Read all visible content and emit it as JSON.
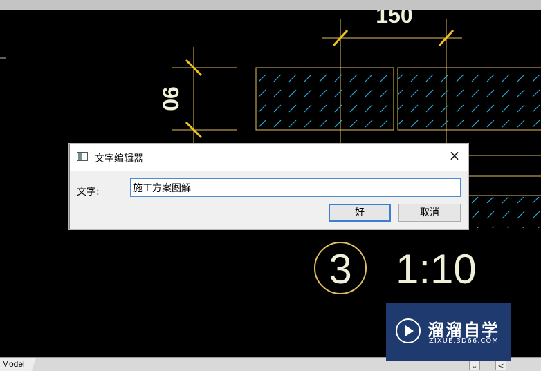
{
  "cad": {
    "dim_top": "150",
    "dim_left": "90",
    "detail_number": "3",
    "scale_label": "1:10",
    "colors": {
      "lines": "#e0c060",
      "hatch": "#2aa8d8",
      "background": "#000000"
    }
  },
  "dialog": {
    "title": "文字编辑器",
    "close_symbol": "×",
    "field_label": "文字:",
    "field_value": "施工方案图解",
    "ok_label": "好",
    "cancel_label": "取消"
  },
  "statusbar": {
    "tab_label": "Model",
    "scroll_down_icon": "⌄",
    "scroll_left_icon": "<"
  },
  "watermark": {
    "main_text": "溜溜自学",
    "sub_text": "ZIXUE.3D66.COM",
    "color": "#1e3a6e"
  }
}
